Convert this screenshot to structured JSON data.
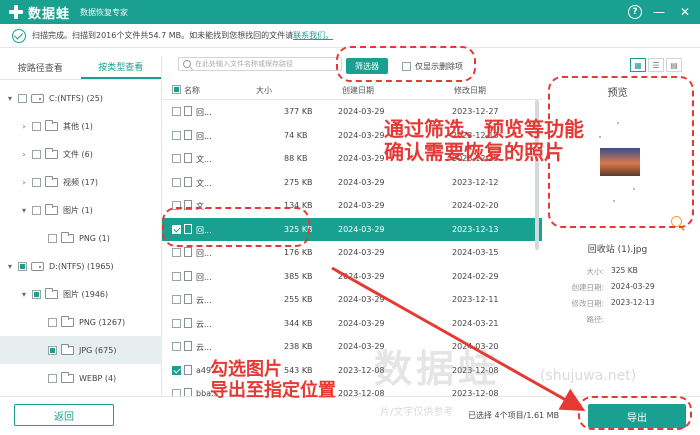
{
  "titlebar": {
    "app_name": "数据蛙",
    "subtitle": "数据恢复专家",
    "help": "?",
    "minimize": "—",
    "close": "✕"
  },
  "status": {
    "text": "扫描完成。扫描到2016个文件共54.7 MB。如未能找到您想找回的文件请",
    "link": "联系我们。"
  },
  "tabs": [
    {
      "label": "按路径查看"
    },
    {
      "label": "按类型查看"
    }
  ],
  "tree": [
    {
      "label": "C:(NTFS) (25)"
    },
    {
      "label": "其他 (1)"
    },
    {
      "label": "文件 (6)"
    },
    {
      "label": "视频 (17)"
    },
    {
      "label": "图片 (1)"
    },
    {
      "label": "PNG (1)"
    },
    {
      "label": "D:(NTFS) (1965)"
    },
    {
      "label": "图片 (1946)"
    },
    {
      "label": "PNG (1267)"
    },
    {
      "label": "JPG (675)"
    },
    {
      "label": "WEBP (4)"
    }
  ],
  "toolbar": {
    "search_placeholder": "在此处输入文件名称或保存路径",
    "filter_label": "筛选器",
    "deleted_only_label": "仅显示删除项"
  },
  "table": {
    "headers": {
      "name": "名称",
      "size": "大小",
      "created": "创建日期",
      "modified": "修改日期"
    },
    "rows": [
      {
        "name": "回...",
        "size": "377 KB",
        "created": "2024-03-29",
        "modified": "2023-12-27"
      },
      {
        "name": "回...",
        "size": "74 KB",
        "created": "2024-03-29",
        "modified": "2023-12-18"
      },
      {
        "name": "文...",
        "size": "88 KB",
        "created": "2024-03-29",
        "modified": "2023-12-25"
      },
      {
        "name": "文...",
        "size": "275 KB",
        "created": "2024-03-29",
        "modified": "2023-12-12"
      },
      {
        "name": "文...",
        "size": "134 KB",
        "created": "2024-03-29",
        "modified": "2024-02-20"
      },
      {
        "name": "回...",
        "size": "325 KB",
        "created": "2024-03-29",
        "modified": "2023-12-13"
      },
      {
        "name": "回...",
        "size": "176 KB",
        "created": "2024-03-29",
        "modified": "2024-03-15"
      },
      {
        "name": "回...",
        "size": "385 KB",
        "created": "2024-03-29",
        "modified": "2024-02-29"
      },
      {
        "name": "云...",
        "size": "255 KB",
        "created": "2024-03-29",
        "modified": "2023-12-11"
      },
      {
        "name": "云...",
        "size": "344 KB",
        "created": "2024-03-29",
        "modified": "2024-03-21"
      },
      {
        "name": "云...",
        "size": "238 KB",
        "created": "2024-03-29",
        "modified": "2024-03-20"
      },
      {
        "name": "a49...",
        "size": "543 KB",
        "created": "2023-12-08",
        "modified": "2023-12-08"
      },
      {
        "name": "bba...",
        "size": "",
        "created": "2023-12-08",
        "modified": "2023-12-08"
      }
    ]
  },
  "preview": {
    "title": "预览",
    "file_name": "回收站 (1).jpg",
    "size_label": "大小:",
    "size": "325 KB",
    "created_label": "创建日期:",
    "created": "2024-03-29",
    "modified_label": "修改日期:",
    "modified": "2023-12-13",
    "path_label": "路径:"
  },
  "bottom": {
    "back_label": "返回",
    "selected_info": "已选择 4个项目/1.61 MB",
    "export_label": "导出"
  },
  "annotations": {
    "preview_line1": "通过筛选、预览等功能",
    "preview_line2": "确认需要恢复的照片",
    "export_line1": "勾选图片",
    "export_line2": "导出至指定位置"
  },
  "watermark": {
    "main": "数据蛙",
    "url": "(shujuwa.net)",
    "sub": "片/文字仅供参考"
  },
  "colors": {
    "brand": "#1aa091",
    "annotation": "#e53935",
    "zoom": "#f3a52b"
  }
}
